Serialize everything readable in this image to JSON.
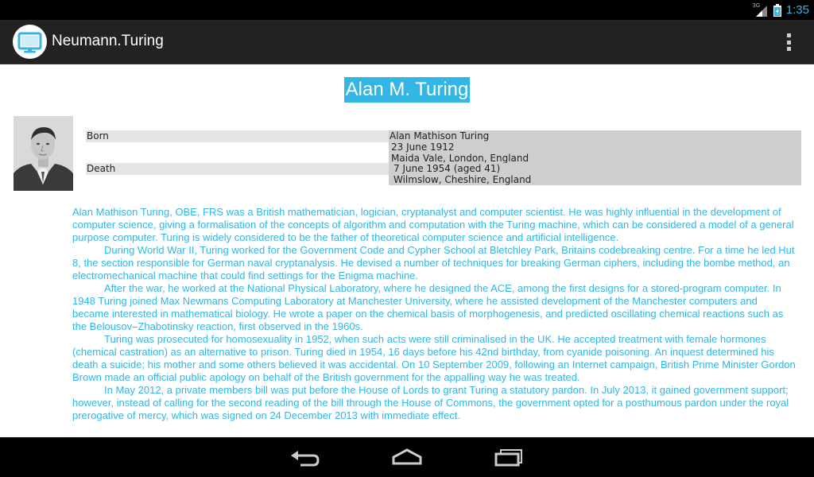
{
  "status_bar": {
    "network_type": "3G",
    "time": "1:35"
  },
  "action_bar": {
    "title": "Neumann.Turing",
    "app_icon": "monitor-icon",
    "overflow_icon": "overflow-menu-icon"
  },
  "page": {
    "title": "Alan M. Turing",
    "infobox": {
      "born_label": "Born",
      "born_lines": [
        "Alan Mathison Turing",
        "23 June 1912",
        "Maida Vale, London, England"
      ],
      "death_label": "Death",
      "death_lines": [
        "7 June 1954 (aged 41)",
        "Wilmslow, Cheshire, England"
      ]
    },
    "paragraphs": [
      "Alan Mathison Turing, OBE, FRS was a British mathematician, logician, cryptanalyst and computer scientist. He was highly influential in the development of computer science, giving a formalisation of the concepts of algorithm and computation with the Turing machine, which can be considered a model of a general purpose computer. Turing is widely considered to be the father of theoretical computer science and artificial intelligence.",
      "During World War II, Turing worked for the Government Code and Cypher School at Bletchley Park, Britains codebreaking centre. For a time he led Hut 8, the section responsible for German naval cryptanalysis. He devised a number of techniques for breaking German ciphers, including the bombe method, an electromechanical machine that could find settings for the Enigma machine.",
      "After the war, he worked at the National Physical Laboratory, where he designed the ACE, among the first designs for a stored-program computer. In 1948 Turing joined Max Newmans Computing Laboratory at Manchester University, where he assisted development of the Manchester computers and became interested in mathematical biology. He wrote a paper on the chemical basis of morphogenesis, and predicted oscillating chemical reactions such as the Belousov–Zhabotinsky reaction, first observed in the 1960s.",
      "Turing was prosecuted for homosexuality in 1952, when such acts were still criminalised in the UK. He accepted treatment with female hormones (chemical castration) as an alternative to prison. Turing died in 1954, 16 days before his 42nd birthday, from cyanide poisoning. An inquest determined his death a suicide; his mother and some others believed it was accidental. On 10 September 2009, following an Internet campaign, British Prime Minister Gordon Brown made an official public apology on behalf of the British government for the appalling way he was treated.",
      "In May 2012, a private members bill was put before the House of Lords to grant Turing a statutory pardon. In July 2013, it gained government support; however, instead of calling for the second reading of the bill through the House of Commons, the government opted for a posthumous pardon under the royal prerogative of mercy, which was signed on 24 December 2013 with immediate effect."
    ]
  },
  "nav_bar": {
    "back_icon": "back-icon",
    "home_icon": "home-icon",
    "recents_icon": "recent-apps-icon"
  },
  "colors": {
    "accent": "#33b5e5",
    "action_bar": "#222222",
    "infobox_label_bg": "#e4e4e4",
    "infobox_value_bg": "#cfcdd0"
  }
}
